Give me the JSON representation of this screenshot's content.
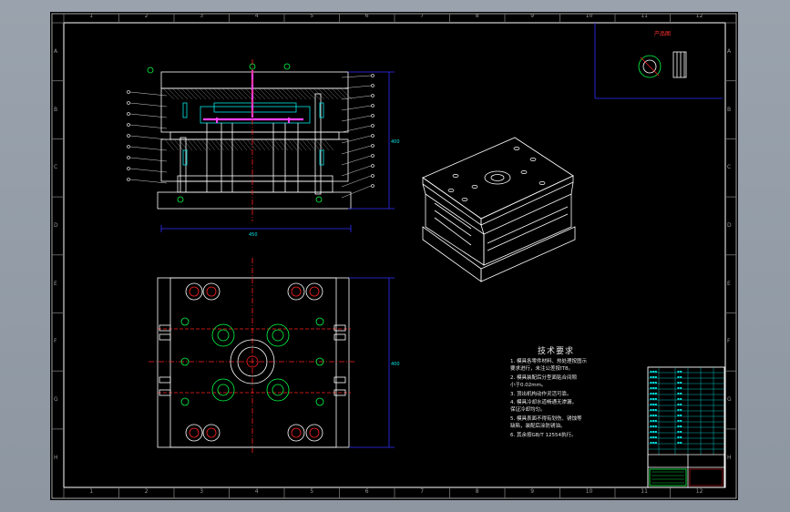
{
  "drawing": {
    "ruler_top": [
      "1",
      "2",
      "3",
      "4",
      "5",
      "6",
      "7",
      "8",
      "9",
      "10",
      "11",
      "12"
    ],
    "ruler_side": [
      "A",
      "B",
      "C",
      "D",
      "E",
      "F",
      "G",
      "H"
    ],
    "product_view_label": "产品图",
    "dims": {
      "height_right": "400",
      "width_bottom": "450",
      "plan_right": "400"
    },
    "tech_title": "技术要求",
    "tech_lines": [
      "1. 模具各零件材料、热处理按图示",
      "   要求进行，未注公差按IT8。",
      "2. 模具装配后分型面贴合间隙",
      "   小于0.02mm。",
      "3. 顶出机构动作灵活可靠。",
      "4. 模具冷却水道畅通无渗漏，",
      "   保证冷却均匀。",
      "5. 模具表面不得有划伤、锈蚀等",
      "   缺陷，装配后涂防锈油。",
      "6. 其余按GB/T 12554执行。"
    ]
  },
  "colors": {
    "paper": "#000000",
    "frame": "#ffffff",
    "part": "#ffffff",
    "centerline": "#ff2020",
    "hidden": "#00e5e5",
    "sprue": "#ff40ff",
    "bolts": "#00ff44",
    "dim": "#3030ff",
    "title_block": "#00e5e5"
  }
}
